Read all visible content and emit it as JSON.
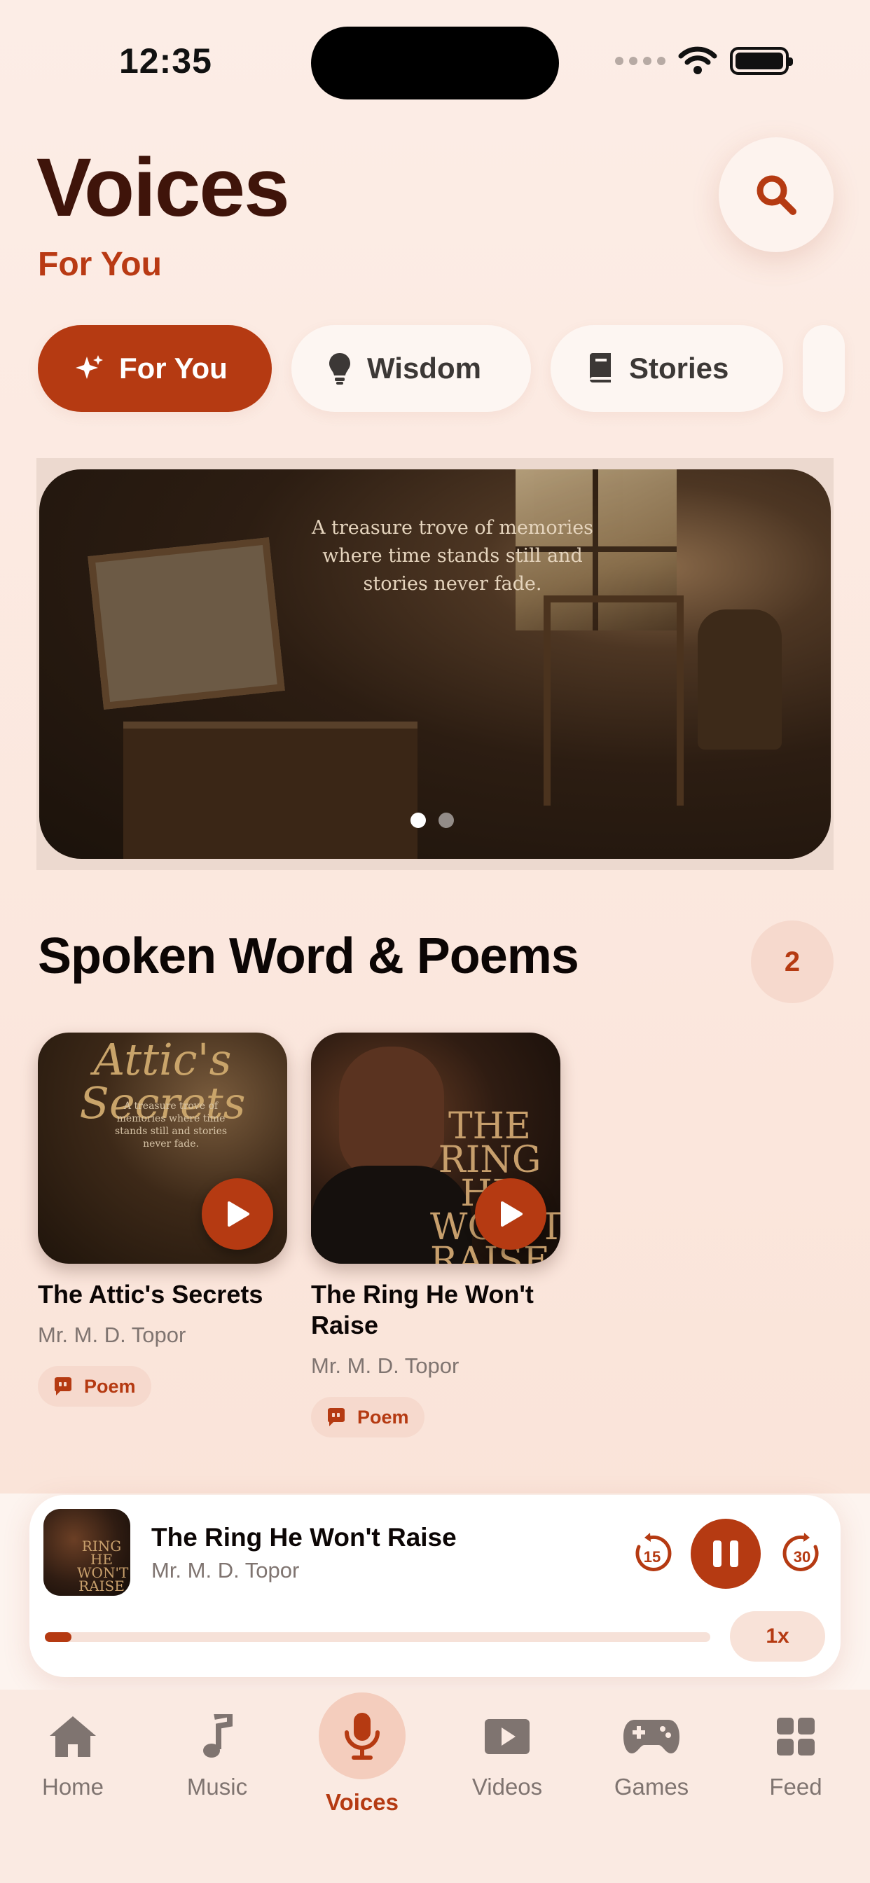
{
  "status_bar": {
    "time": "12:35"
  },
  "header": {
    "title": "Voices",
    "subtitle": "For You"
  },
  "categories": [
    {
      "label": "For You",
      "icon": "sparkle-icon",
      "active": true
    },
    {
      "label": "Wisdom",
      "icon": "lightbulb-icon",
      "active": false
    },
    {
      "label": "Stories",
      "icon": "book-icon",
      "active": false
    }
  ],
  "banner": {
    "text": "A treasure trove of memories where time stands still and stories never fade.",
    "page_count": 2,
    "current_page": 1
  },
  "section": {
    "title": "Spoken Word & Poems",
    "count": "2"
  },
  "cards": [
    {
      "title": "The Attic's Secrets",
      "author": "Mr. M. D. Topor",
      "tag": "Poem",
      "art_title": "Attic's Secrets",
      "art_sub": "A treasure trove of memories where time stands still and stories never fade."
    },
    {
      "title": "The Ring He Won't Raise",
      "author": "Mr. M. D. Topor",
      "tag": "Poem",
      "art_title": "THE RING HE WON'T RAISE"
    }
  ],
  "player": {
    "title": "The Ring He Won't Raise",
    "author": "Mr. M. D. Topor",
    "skip_back": "15",
    "skip_forward": "30",
    "speed": "1x",
    "progress": 0.04,
    "art_title": "RING HE WON'T RAISE"
  },
  "tabs": [
    {
      "label": "Home",
      "icon": "home-icon",
      "active": false
    },
    {
      "label": "Music",
      "icon": "music-note-icon",
      "active": false
    },
    {
      "label": "Voices",
      "icon": "microphone-icon",
      "active": true
    },
    {
      "label": "Videos",
      "icon": "video-play-icon",
      "active": false
    },
    {
      "label": "Games",
      "icon": "gamepad-icon",
      "active": false
    },
    {
      "label": "Feed",
      "icon": "grid-icon",
      "active": false
    }
  ],
  "colors": {
    "accent": "#b53a12",
    "title": "#3f140a",
    "background": "#fcede6"
  }
}
